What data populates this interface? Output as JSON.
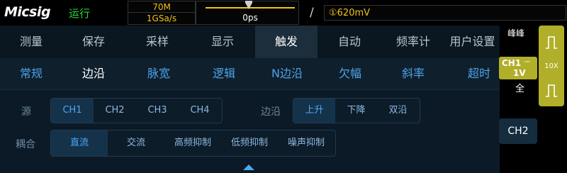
{
  "topbar": {
    "brand": "Micsig",
    "run_status": "运行",
    "memory_depth": "70M",
    "sample_rate": "1GSa/s",
    "time_offset": "0ps",
    "trigger_slope_icon": "rising-edge-slash-icon",
    "trigger_level": "①620mV"
  },
  "tabs": [
    "测量",
    "保存",
    "采样",
    "显示",
    "触发",
    "自动",
    "频率计",
    "用户设置"
  ],
  "active_tab": "触发",
  "subtabs": [
    "常规",
    "边沿",
    "脉宽",
    "逻辑",
    "N边沿",
    "欠幅",
    "斜率",
    "超时"
  ],
  "active_subtab": "边沿",
  "source": {
    "label": "源",
    "options": [
      "CH1",
      "CH2",
      "CH3",
      "CH4"
    ],
    "selected": "CH1"
  },
  "edge": {
    "label": "边沿",
    "options": [
      "上升",
      "下降",
      "双沿"
    ],
    "selected": "上升"
  },
  "coupling": {
    "label": "耦合",
    "options": [
      "直流",
      "交流",
      "高频抑制",
      "低频抑制",
      "噪声抑制"
    ],
    "selected": "直流"
  },
  "right_panel": {
    "measure_label": "峰峰",
    "ch1_label": "CH1",
    "ch1_coupling_icon": "dc-coupling-icon",
    "ch1_scale": "1V",
    "ch1_bandwidth": "全",
    "probe_ratio": "10X",
    "ch2_label": "CH2"
  },
  "colors": {
    "run_green": "#28d63c",
    "acq_yellow": "#f0c419",
    "ch1_olive": "#b1ae2a",
    "accent_blue": "#4da8f0"
  }
}
